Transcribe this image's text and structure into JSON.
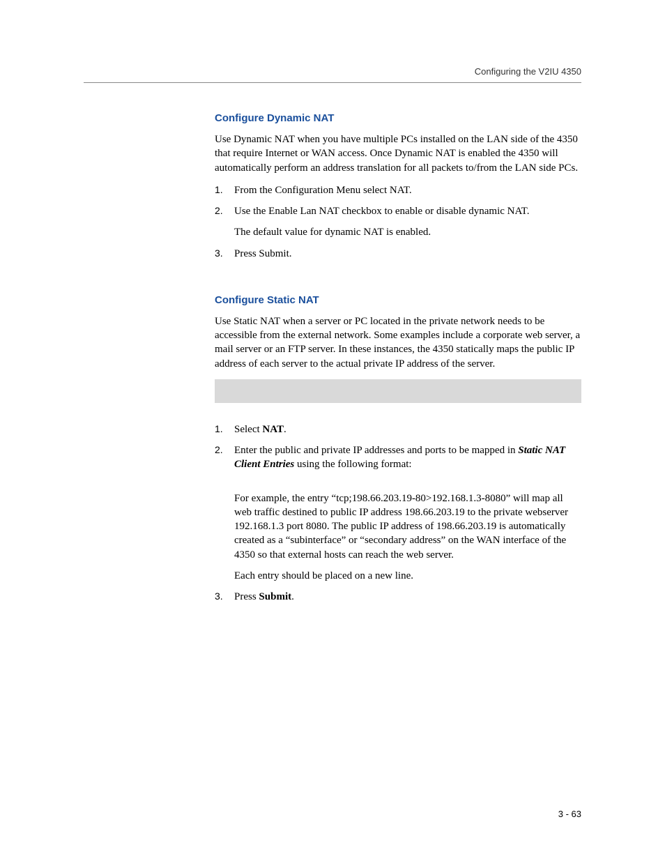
{
  "header": {
    "running_title": "Configuring the V2IU 4350"
  },
  "sections": [
    {
      "heading": "Configure Dynamic NAT",
      "intro": "Use Dynamic NAT when you have multiple PCs installed on the LAN side of the 4350 that require Internet or WAN access. Once Dynamic NAT is enabled the 4350 will automatically perform an address translation for all packets to/from the LAN side PCs.",
      "steps": [
        {
          "text": "From the Configuration Menu select NAT."
        },
        {
          "text": "Use the Enable Lan NAT checkbox to enable or disable dynamic NAT.",
          "sub": [
            "The default value for dynamic NAT is enabled."
          ]
        },
        {
          "text": "Press Submit."
        }
      ]
    },
    {
      "heading": "Configure Static NAT",
      "intro": "Use Static NAT when a server or PC located in the private network needs to be accessible from the external network. Some examples include a corporate web server, a mail server or an FTP server. In these instances, the 4350 statically maps the public IP address of each server to the actual private IP address of the server.",
      "steps2": {
        "item1_prefix": "Select ",
        "item1_bold": "NAT",
        "item1_suffix": ".",
        "item2_prefix": "Enter the public and private IP addresses and ports to be mapped in ",
        "item2_ital": "Static NAT Client Entries",
        "item2_suffix": " using the following format:",
        "item2_sub1": "For example, the entry “tcp;198.66.203.19-80>192.168.1.3-8080” will map all web traffic destined to public IP address 198.66.203.19 to the private webserver 192.168.1.3 port 8080. The public IP address of 198.66.203.19 is automatically created as a “subinterface” or “secondary address” on the WAN interface of the 4350 so that external hosts can reach the web server.",
        "item2_sub2": "Each entry should be placed on a new line.",
        "item3_prefix": "Press ",
        "item3_bold": "Submit",
        "item3_suffix": "."
      }
    }
  ],
  "footer": {
    "page_number": "3 - 63"
  }
}
